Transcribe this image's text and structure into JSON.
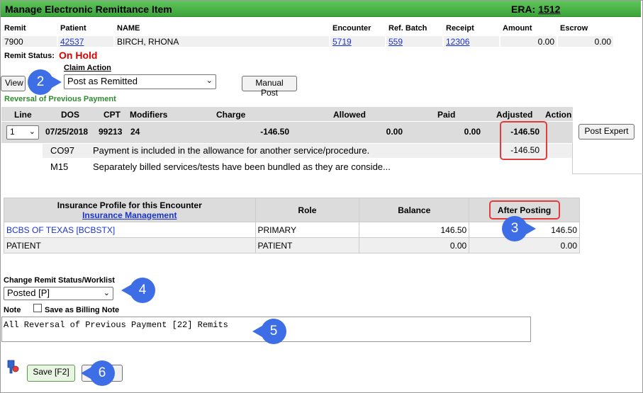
{
  "window": {
    "title": "Manage Electronic Remittance Item",
    "era_label": "ERA:",
    "era_number": "1512"
  },
  "remit_header": {
    "remit": "Remit",
    "patient": "Patient",
    "name": "NAME",
    "encounter": "Encounter",
    "ref_batch": "Ref. Batch",
    "receipt": "Receipt",
    "amount": "Amount",
    "escrow": "Escrow"
  },
  "remit_values": {
    "remit": "7900",
    "patient": "42537",
    "name": "BIRCH, RHONA",
    "encounter": "5719",
    "ref_batch": "559",
    "receipt": "12306",
    "amount": "0.00",
    "escrow": "0.00"
  },
  "status": {
    "label": "Remit Status:",
    "value": "On Hold"
  },
  "claim_action": {
    "label": "Claim Action",
    "selected": "Post as Remitted"
  },
  "buttons": {
    "view": "View",
    "manual_post": "Manual Post",
    "post_expert": "Post Expert",
    "save": "Save [F2]"
  },
  "reversal_label": "Reversal of Previous Payment",
  "lines_header": [
    "Line",
    "DOS",
    "CPT",
    "Modifiers",
    "Charge",
    "Allowed",
    "Paid",
    "Adjusted",
    "Action"
  ],
  "line": {
    "number": "1",
    "dos": "07/25/2018",
    "cpt": "99213",
    "modifier": "24",
    "charge": "-146.50",
    "allowed": "0.00",
    "paid": "0.00",
    "adjusted": "-146.50"
  },
  "adjustments": [
    {
      "code": "CO97",
      "desc": "Payment is included in the allowance for another service/procedure.",
      "amount": "-146.50"
    },
    {
      "code": "M15",
      "desc": "Separately billed services/tests have been bundled as they are conside...",
      "amount": ""
    }
  ],
  "insurance": {
    "header_title": "Insurance Profile for this Encounter",
    "header_link": "Insurance Management",
    "col_role": "Role",
    "col_balance": "Balance",
    "col_after": "After Posting",
    "rows": [
      {
        "name": "BCBS OF TEXAS [BCBSTX]",
        "role": "PRIMARY",
        "balance": "146.50",
        "after": "146.50"
      },
      {
        "name": "PATIENT",
        "role": "PATIENT",
        "balance": "0.00",
        "after": "0.00"
      }
    ]
  },
  "worklist": {
    "label": "Change Remit Status/Worklist",
    "selected": "Posted [P]"
  },
  "note": {
    "label": "Note",
    "billing_label": "Save as Billing Note",
    "text": "All Reversal of Previous Payment [22] Remits"
  },
  "callouts": [
    "2",
    "3",
    "4",
    "5",
    "6"
  ],
  "colors": {
    "title_green": "#4cb84a",
    "callout_blue": "#3d6ee6",
    "status_red": "#e00000",
    "highlight_red": "#e03c3c"
  }
}
